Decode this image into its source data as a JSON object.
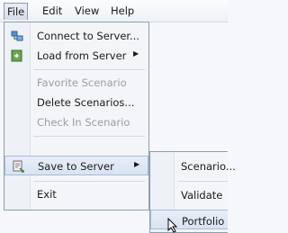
{
  "menubar": {
    "file": "File",
    "edit": "Edit",
    "view": "View",
    "help": "Help"
  },
  "file_menu": {
    "connect": "Connect to Server...",
    "load": "Load from Server",
    "favorite": "Favorite Scenario",
    "delete": "Delete Scenarios...",
    "checkin": "Check In Scenario",
    "save": "Save to Server",
    "exit": "Exit"
  },
  "save_submenu": {
    "scenario": "Scenario...",
    "validate": "Validate",
    "portfolio": "Portfolio"
  },
  "colors": {
    "highlight_border": "#a9bbd6",
    "menu_border": "#8e9db2",
    "disabled_text": "#9a9ea6"
  }
}
